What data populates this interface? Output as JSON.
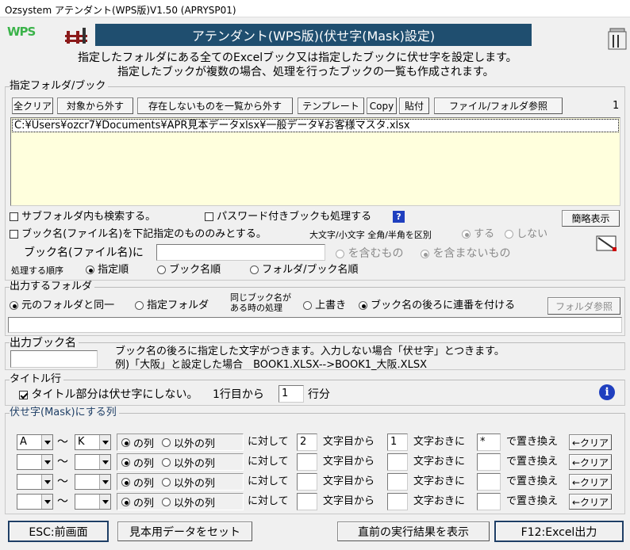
{
  "window": {
    "title": "Ozsystem アテンダント(WPS版)V1.50 (APRYSP01)"
  },
  "logo": {
    "text": "WPS"
  },
  "header": {
    "title": "アテンダント(WPS版)(伏せ字(Mask)設定)",
    "desc1": "指定したフォルダにある全てのExcelブック又は指定したブックに伏せ字を設定します。",
    "desc2": "指定したブックが複数の場合、処理を行ったブックの一覧も作成されます。"
  },
  "folder_section": {
    "legend": "指定フォルダ/ブック",
    "buttons": [
      "全クリア",
      "対象から外す",
      "存在しないものを一覧から外す",
      "テンプレート",
      "Copy",
      "貼付",
      "ファイル/フォルダ参照"
    ],
    "count": "1",
    "list": [
      "C:¥Users¥ozcr7¥Documents¥APR見本データxlsx¥一般データ¥お客様マスタ.xlsx"
    ],
    "subfolder_label": "サブフォルダ内も検索する。",
    "password_label": "パスワード付きブックも処理する",
    "help_mark": "?",
    "simple_btn": "簡略表示",
    "bookname_only_label": "ブック名(ファイル名)を下記指定のもののみとする。",
    "case_label": "大文字/小文字 全角/半角を区別",
    "case_yes": "する",
    "case_no": "しない",
    "bookname_label": "ブック名(ファイル名)に",
    "bookname_value": "",
    "contains": "を含むもの",
    "not_contains": "を含まないもの",
    "order_label": "処理する順序",
    "order_options": [
      "指定順",
      "ブック名順",
      "フォルダ/ブック名順"
    ]
  },
  "output_folder": {
    "legend": "出力するフォルダ",
    "same": "元のフォルダと同一",
    "specified": "指定フォルダ",
    "same_name_label1": "同じブック名が",
    "same_name_label2": "ある時の処理",
    "overwrite": "上書き",
    "append_seq": "ブック名の後ろに連番を付ける",
    "browse_btn": "フォルダ参照",
    "path_value": ""
  },
  "output_book": {
    "legend": "出力ブック名",
    "value": "",
    "desc1": "ブック名の後ろに指定した文字がつきます。入力しない場合「伏せ字」とつきます。",
    "desc2": "例)「大阪」と設定した場合　BOOK1.XLSX-->BOOK1_大阪.XLSX"
  },
  "title_row": {
    "legend": "タイトル行",
    "label": "タイトル部分は伏せ字にしない。",
    "from_label": "1行目から",
    "rows_value": "1",
    "rows_unit": "行分",
    "info_mark": "i"
  },
  "mask": {
    "legend": "伏せ字(Mask)にする列",
    "tilde": "～",
    "col_of": "の列",
    "col_except": "以外の列",
    "against": "に対して",
    "from_char": "文字目から",
    "every_char": "文字おきに",
    "replace": "で置き換え",
    "clear": "←クリア",
    "rows": [
      {
        "from_col": "A",
        "to_col": "K",
        "start": "2",
        "interval": "1",
        "char": "*"
      },
      {
        "from_col": "",
        "to_col": "",
        "start": "",
        "interval": "",
        "char": ""
      },
      {
        "from_col": "",
        "to_col": "",
        "start": "",
        "interval": "",
        "char": ""
      },
      {
        "from_col": "",
        "to_col": "",
        "start": "",
        "interval": "",
        "char": ""
      }
    ]
  },
  "footer": {
    "esc": "ESC:前画面",
    "sample": "見本用データをセット",
    "last_result": "直前の実行結果を表示",
    "f12": "F12:Excel出力"
  },
  "colors": {
    "header_bg": "#1f4e6f",
    "list_bg": "#ffffdd",
    "accent_border": "#1f3f66",
    "help_blue": "#1f3fbf"
  }
}
